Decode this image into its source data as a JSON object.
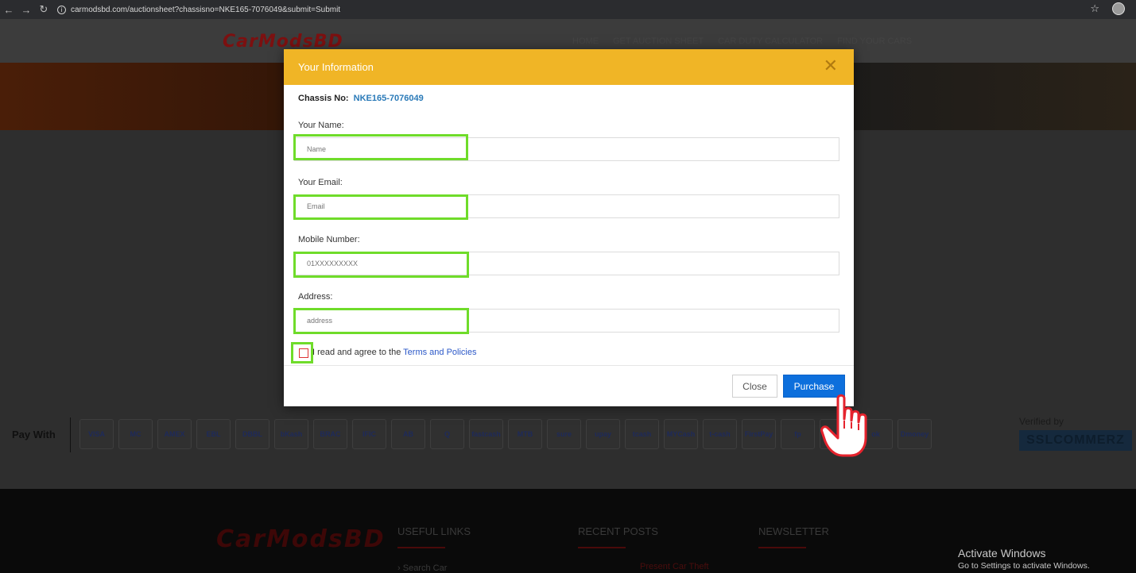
{
  "browser": {
    "url": "carmodsbd.com/auctionsheet?chassisno=NKE165-7076049&submit=Submit"
  },
  "site": {
    "logo": "CarModsBD",
    "nav": [
      "HOME",
      "GET AUCTION SHEET",
      "CAR DUTY CALCULATOR",
      "FIND YOUR CARS"
    ]
  },
  "modal": {
    "title": "Your Information",
    "chassis_label": "Chassis No:",
    "chassis_value": "NKE165-7076049",
    "name_label": "Your Name:",
    "name_placeholder": "Name",
    "email_label": "Your Email:",
    "email_placeholder": "Email",
    "mobile_label": "Mobile Number:",
    "mobile_placeholder": "01XXXXXXXXX",
    "address_label": "Address:",
    "address_placeholder": "address",
    "agree_text": "I read and agree to the",
    "agree_link": "Terms and Policies",
    "close_button": "Close",
    "purchase_button": "Purchase"
  },
  "payment": {
    "label": "Pay With",
    "icons": [
      "VISA",
      "MC",
      "AMEX",
      "EBL",
      "DBBL",
      "bKash",
      "BRAC",
      "IFIC",
      "AB",
      "Q",
      "fastcash",
      "MTB",
      "sure",
      "upay",
      "tcash",
      "MYCash",
      "t-cash",
      "FirstPay",
      "fp",
      "ipay",
      "ok",
      "Dmoney"
    ],
    "verified_by": "Verified by",
    "provider": "SSLCOMMERZ"
  },
  "footer": {
    "logo": "CarModsBD",
    "col1": "USEFUL LINKS",
    "col2": "RECENT POSTS",
    "col3": "NEWSLETTER",
    "link1": "Search Car",
    "post1": "Present Car Theft"
  },
  "os": {
    "activate_title": "Activate Windows",
    "activate_sub": "Go to Settings to activate Windows."
  },
  "colors": {
    "modal_header": "#f0b526",
    "highlight": "#6fdc2a",
    "primary": "#0d6fdc"
  }
}
